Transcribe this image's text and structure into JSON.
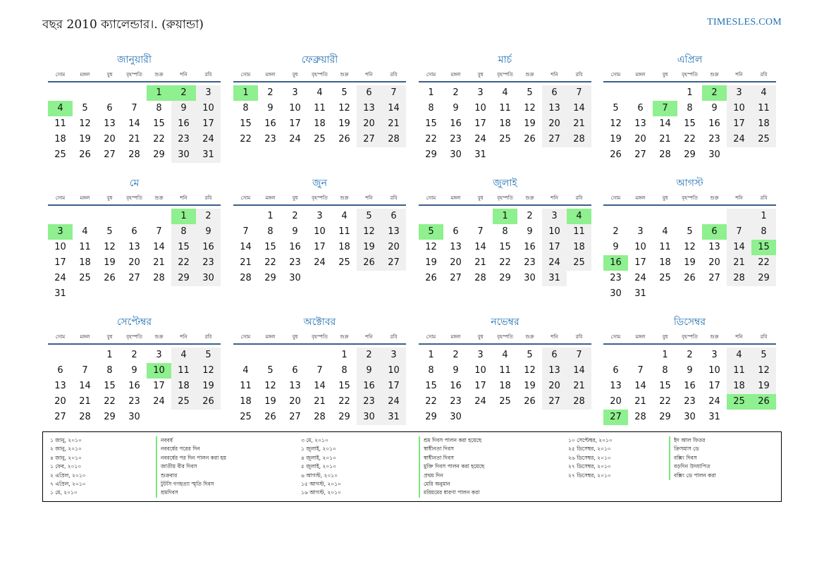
{
  "header": {
    "title": "বছর 2010 ক্যালেন্ডার।. (রুয়ান্ডা)",
    "site": "TIMESLES.COM"
  },
  "weekdays": [
    "সোম",
    "মঙ্গল",
    "বুধ",
    "বৃহস্পতি",
    "শুক্র",
    "শনি",
    "রবি"
  ],
  "months": [
    {
      "name": "জানুয়ারী",
      "offset": 4,
      "days": 31,
      "holidays": [
        1,
        2,
        4
      ]
    },
    {
      "name": "ফেব্রুয়ারী",
      "offset": 0,
      "days": 28,
      "holidays": [
        1
      ]
    },
    {
      "name": "মার্চ",
      "offset": 0,
      "days": 31,
      "holidays": []
    },
    {
      "name": "এপ্রিল",
      "offset": 3,
      "days": 30,
      "holidays": [
        2,
        7
      ]
    },
    {
      "name": "মে",
      "offset": 5,
      "days": 31,
      "holidays": [
        1,
        3
      ]
    },
    {
      "name": "জুন",
      "offset": 1,
      "days": 30,
      "holidays": []
    },
    {
      "name": "জুলাই",
      "offset": 3,
      "days": 31,
      "holidays": [
        1,
        4,
        5
      ]
    },
    {
      "name": "আগস্ট",
      "offset": 6,
      "days": 31,
      "holidays": [
        6,
        15,
        16
      ]
    },
    {
      "name": "সেপ্টেম্বর",
      "offset": 2,
      "days": 30,
      "holidays": [
        10
      ]
    },
    {
      "name": "অক্টোবর",
      "offset": 4,
      "days": 31,
      "holidays": []
    },
    {
      "name": "নভেম্বর",
      "offset": 0,
      "days": 30,
      "holidays": []
    },
    {
      "name": "ডিসেম্বর",
      "offset": 2,
      "days": 31,
      "holidays": [
        25,
        26,
        27
      ]
    }
  ],
  "holidays": {
    "col1_dates": [
      "১ জানু, ২০১০",
      "২ জানু, ২০১০",
      "৪ জানু, ২০১০",
      "১ ফেব, ২০১০",
      "২ এপ্রিল, ২০১০",
      "৭ এপ্রিল, ২০১০",
      "১ মে, ২০১০"
    ],
    "col1_names": [
      "নববর্ষ",
      "নববর্ষের পরের দিন",
      "নববর্ষের পর দিন পালন করা হয়",
      "জাতীয় বীর দিবস",
      "শুক্রবার",
      "টুটসি গণহত্যা স্মৃতি দিবস",
      "শ্রমদিবস"
    ],
    "col2_dates": [
      "৩ মে, ২০১০",
      "১ জুলাই, ২০১০",
      "৪ জুলাই, ২০১০",
      "৫ জুলাই, ২০১০",
      "৬ আগস্ট, ২০১০",
      "১৫ আগস্ট, ২০১০",
      "১৬ আগস্ট, ২০১০"
    ],
    "col2_names": [
      "শ্রম দিবস পালন করা হয়েছে",
      "স্বাধীনতা দিবস",
      "স্বাধীনতা দিবস",
      "মুক্তি দিবস পালন করা হয়েছে",
      "প্রথম দিন",
      "মেরি অনুমান",
      "মরিয়মের ধারণা পালন করা"
    ],
    "col3_dates": [
      "১০ সেপ্টেম্বর, ২০১০",
      "২৫ ডিসেম্বর, ২০১০",
      "২৬ ডিসেম্বর, ২০১০",
      "২৭ ডিসেম্বর, ২০১০",
      "২৭ ডিসেম্বর, ২০১০"
    ],
    "col3_names": [
      "ইদ আল ফিতর",
      "ক্রিসমাস ডে",
      "বক্সিং দিবস",
      "বড়দিন উদযাপিত",
      "বক্সিং ডে পালন করা"
    ]
  }
}
